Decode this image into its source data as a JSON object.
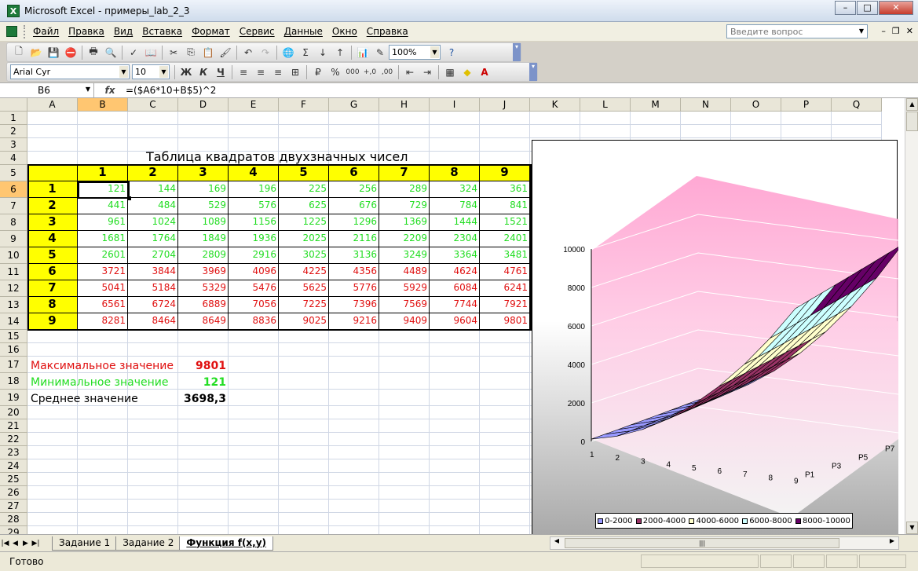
{
  "window": {
    "title": "Microsoft Excel - примеры_lab_2_3",
    "app_icon": "X"
  },
  "menu": {
    "items": [
      "Файл",
      "Правка",
      "Вид",
      "Вставка",
      "Формат",
      "Сервис",
      "Данные",
      "Окно",
      "Справка"
    ],
    "ask_placeholder": "Введите вопрос"
  },
  "toolbar": {
    "zoom": "100%",
    "font_name": "Arial Cyr",
    "font_size": "10",
    "bold": "Ж",
    "italic": "К",
    "underline": "Ч",
    "percent": "%",
    "thousands": "000"
  },
  "formula_bar": {
    "name_box": "B6",
    "fx": "fx",
    "formula": "=($A6*10+B$5)^2"
  },
  "sheet": {
    "columns": [
      "A",
      "B",
      "C",
      "D",
      "E",
      "F",
      "G",
      "H",
      "I",
      "J",
      "K",
      "L",
      "M",
      "N",
      "O",
      "P",
      "Q"
    ],
    "rows": [
      "1",
      "2",
      "3",
      "4",
      "5",
      "6",
      "7",
      "8",
      "9",
      "10",
      "11",
      "12",
      "13",
      "14",
      "15",
      "16",
      "17",
      "18",
      "19",
      "20",
      "21",
      "22",
      "23",
      "24",
      "25",
      "26",
      "27",
      "28",
      "29"
    ],
    "table_title": "Таблица квадратов двухзначных чисел",
    "col_headers": [
      "1",
      "2",
      "3",
      "4",
      "5",
      "6",
      "7",
      "8",
      "9"
    ],
    "row_headers": [
      "1",
      "2",
      "3",
      "4",
      "5",
      "6",
      "7",
      "8",
      "9"
    ],
    "values": [
      [
        "121",
        "144",
        "169",
        "196",
        "225",
        "256",
        "289",
        "324",
        "361"
      ],
      [
        "441",
        "484",
        "529",
        "576",
        "625",
        "676",
        "729",
        "784",
        "841"
      ],
      [
        "961",
        "1024",
        "1089",
        "1156",
        "1225",
        "1296",
        "1369",
        "1444",
        "1521"
      ],
      [
        "1681",
        "1764",
        "1849",
        "1936",
        "2025",
        "2116",
        "2209",
        "2304",
        "2401"
      ],
      [
        "2601",
        "2704",
        "2809",
        "2916",
        "3025",
        "3136",
        "3249",
        "3364",
        "3481"
      ],
      [
        "3721",
        "3844",
        "3969",
        "4096",
        "4225",
        "4356",
        "4489",
        "4624",
        "4761"
      ],
      [
        "5041",
        "5184",
        "5329",
        "5476",
        "5625",
        "5776",
        "5929",
        "6084",
        "6241"
      ],
      [
        "6561",
        "6724",
        "6889",
        "7056",
        "7225",
        "7396",
        "7569",
        "7744",
        "7921"
      ],
      [
        "8281",
        "8464",
        "8649",
        "8836",
        "9025",
        "9216",
        "9409",
        "9604",
        "9801"
      ]
    ],
    "stats": {
      "max_label": "Максимальное значение",
      "max_value": "9801",
      "min_label": "Минимальное значение",
      "min_value": "121",
      "avg_label": "Среднее значение",
      "avg_value": "3698,3"
    }
  },
  "chart_data": {
    "type": "surface",
    "z_ticks": [
      "0",
      "2000",
      "4000",
      "6000",
      "8000",
      "10000"
    ],
    "x_categories": [
      "1",
      "2",
      "3",
      "4",
      "5",
      "6",
      "7",
      "8",
      "9"
    ],
    "series_axis": [
      "P1",
      "P3",
      "P5",
      "P7"
    ],
    "legend": [
      "0-2000",
      "2000-4000",
      "4000-6000",
      "6000-8000",
      "8000-10000"
    ],
    "band_colors": [
      "#9999ff",
      "#993366",
      "#ffffcc",
      "#ccffff",
      "#660066"
    ]
  },
  "tabs": {
    "items": [
      "Задание 1",
      "Задание 2",
      "Функция f(x,y)"
    ],
    "active": 2
  },
  "status": {
    "text": "Готово"
  },
  "colors": {
    "accent_selected": "#ffc671",
    "header_fill": "#ffff00",
    "green_text": "#22dd22",
    "red_text": "#e01010"
  }
}
